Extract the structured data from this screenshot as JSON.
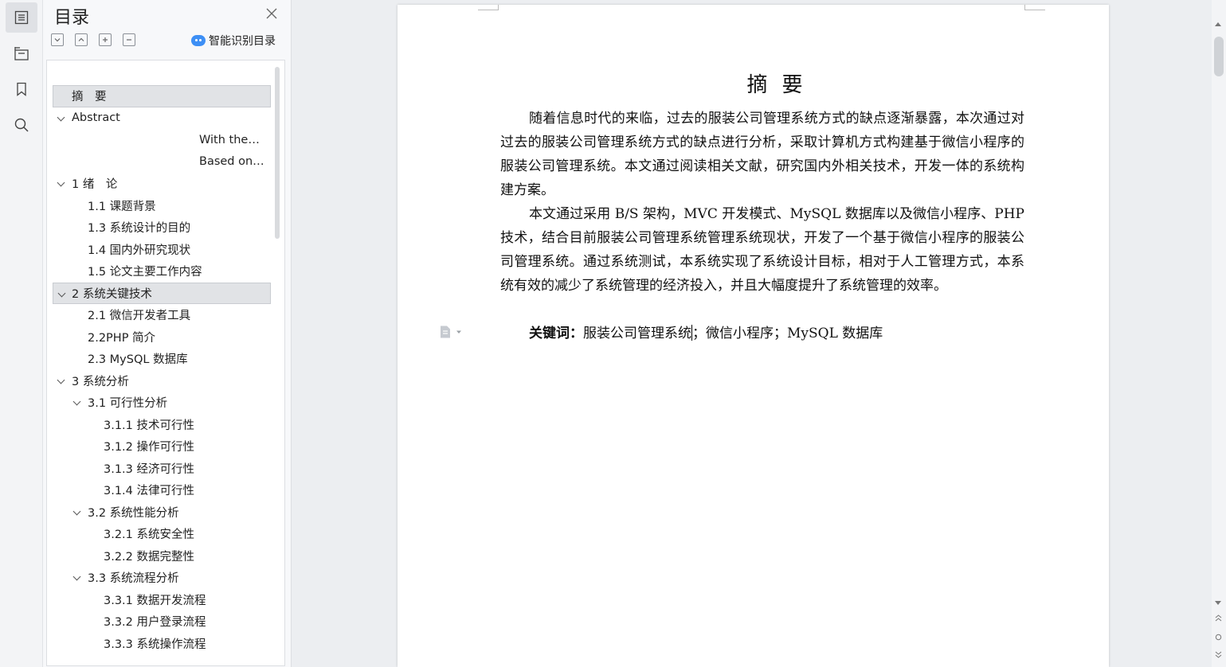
{
  "toc": {
    "title": "目录",
    "smart_label": "智能识别目录",
    "items": [
      {
        "label": "摘　要",
        "level": 0,
        "caret": false,
        "selected": true
      },
      {
        "label": "Abstract",
        "level": 0,
        "caret": true,
        "selected": false
      },
      {
        "label": "With the…",
        "level": 9,
        "caret": false,
        "selected": false
      },
      {
        "label": "Based on…",
        "level": 9,
        "caret": false,
        "selected": false
      },
      {
        "label": "1  绪　论",
        "level": 0,
        "caret": true,
        "selected": false
      },
      {
        "label": "1.1 课题背景",
        "level": 1,
        "caret": false,
        "selected": false
      },
      {
        "label": "1.3 系统设计的目的",
        "level": 1,
        "caret": false,
        "selected": false
      },
      {
        "label": "1.4  国内外研究现状",
        "level": 1,
        "caret": false,
        "selected": false
      },
      {
        "label": "1.5  论文主要工作内容",
        "level": 1,
        "caret": false,
        "selected": false
      },
      {
        "label": "2  系统关键技术",
        "level": 0,
        "caret": true,
        "selected": true
      },
      {
        "label": "2.1 微信开发者工具",
        "level": 1,
        "caret": false,
        "selected": false
      },
      {
        "label": "2.2PHP 简介",
        "level": 1,
        "caret": false,
        "selected": false
      },
      {
        "label": "2.3 MySQL 数据库",
        "level": 1,
        "caret": false,
        "selected": false
      },
      {
        "label": "3  系统分析",
        "level": 0,
        "caret": true,
        "selected": false
      },
      {
        "label": "3.1  可行性分析",
        "level": 1,
        "caret": true,
        "selected": false
      },
      {
        "label": "3.1.1  技术可行性",
        "level": 2,
        "caret": false,
        "selected": false
      },
      {
        "label": "3.1.2  操作可行性",
        "level": 2,
        "caret": false,
        "selected": false
      },
      {
        "label": "3.1.3  经济可行性",
        "level": 2,
        "caret": false,
        "selected": false
      },
      {
        "label": "3.1.4  法律可行性",
        "level": 2,
        "caret": false,
        "selected": false
      },
      {
        "label": "3.2  系统性能分析",
        "level": 1,
        "caret": true,
        "selected": false
      },
      {
        "label": "3.2.1  系统安全性",
        "level": 2,
        "caret": false,
        "selected": false
      },
      {
        "label": "3.2.2  数据完整性",
        "level": 2,
        "caret": false,
        "selected": false
      },
      {
        "label": "3.3  系统流程分析",
        "level": 1,
        "caret": true,
        "selected": false
      },
      {
        "label": "3.3.1  数据开发流程",
        "level": 2,
        "caret": false,
        "selected": false
      },
      {
        "label": "3.3.2  用户登录流程",
        "level": 2,
        "caret": false,
        "selected": false
      },
      {
        "label": "3.3.3  系统操作流程",
        "level": 2,
        "caret": false,
        "selected": false
      }
    ]
  },
  "document": {
    "heading": "摘要",
    "paragraphs": [
      "随着信息时代的来临，过去的服装公司管理系统方式的缺点逐渐暴露，本次通过对过去的服装公司管理系统方式的缺点进行分析，采取计算机方式构建基于微信小程序的服装公司管理系统。本文通过阅读相关文献，研究国内外相关技术，开发一体的系统构建方案。",
      "本文通过采用 B/S 架构，MVC 开发模式、MySQL 数据库以及微信小程序、PHP 技术，结合目前服装公司管理系统管理系统现状，开发了一个基于微信小程序的服装公司管理系统。通过系统测试，本系统实现了系统设计目标，相对于人工管理方式，本系统有效的减少了系统管理的经济投入，并且大幅度提升了系统管理的效率。"
    ],
    "keywords_label": "关键词：",
    "keywords_before_cursor": "服装公司管理系统",
    "keywords_after_cursor": "；微信小程序；MySQL 数据库"
  },
  "icons": [
    "toc-icon",
    "navigation-icon",
    "bookmark-icon",
    "search-icon",
    "close-icon",
    "collapse-all-icon",
    "expand-all-icon",
    "plus-icon",
    "minus-icon",
    "smart-toc-icon",
    "document-float-icon"
  ]
}
